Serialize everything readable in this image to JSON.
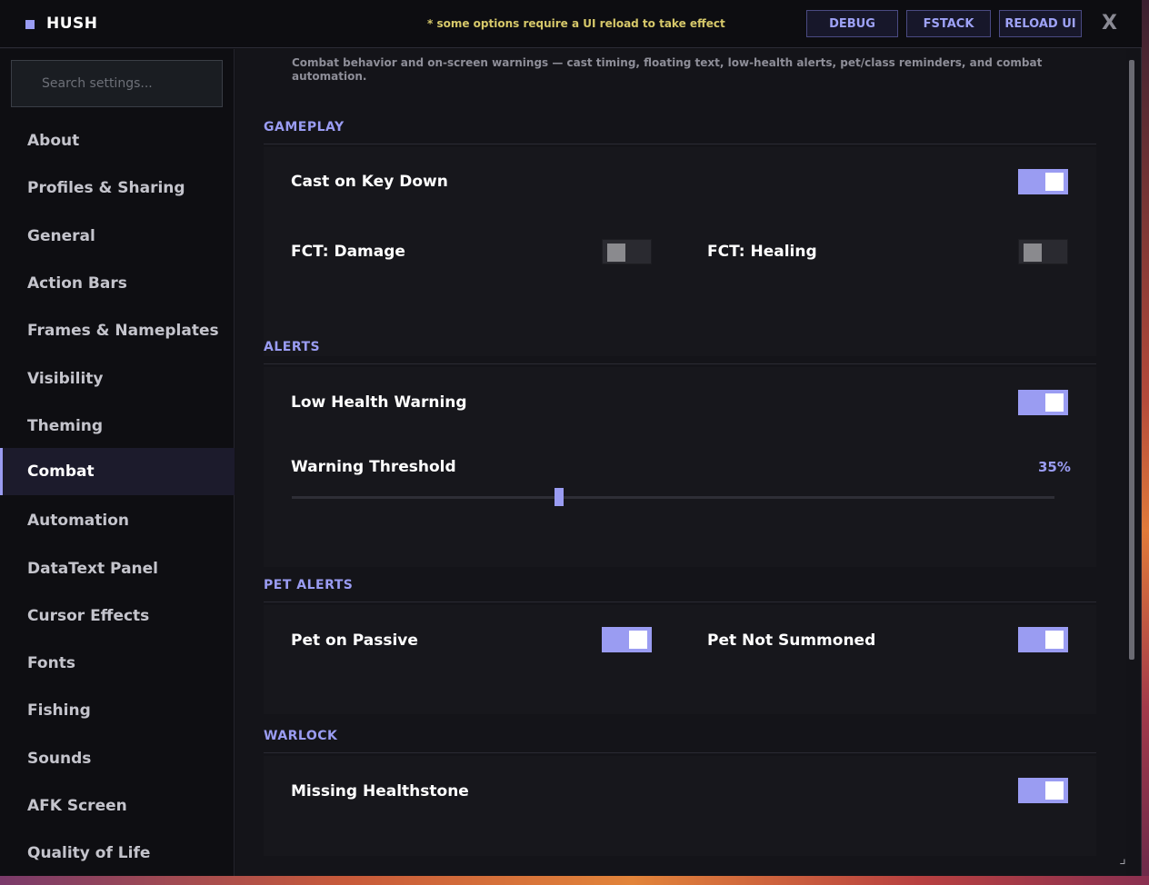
{
  "app": {
    "title": "HUSH",
    "reload_note": "* some options require a UI reload to take effect",
    "buttons": {
      "debug": "DEBUG",
      "fstack": "FSTACK",
      "reload": "RELOAD UI"
    },
    "close_label": "X"
  },
  "sidebar": {
    "search_placeholder": "Search settings...",
    "items": [
      {
        "label": "About"
      },
      {
        "label": "Profiles & Sharing"
      },
      {
        "label": "General"
      },
      {
        "label": "Action Bars"
      },
      {
        "label": "Frames & Nameplates"
      },
      {
        "label": "Visibility"
      },
      {
        "label": "Theming"
      },
      {
        "label": "Combat"
      },
      {
        "label": "Automation"
      },
      {
        "label": "DataText Panel"
      },
      {
        "label": "Cursor Effects"
      },
      {
        "label": "Fonts"
      },
      {
        "label": "Fishing"
      },
      {
        "label": "Sounds"
      },
      {
        "label": "AFK Screen"
      },
      {
        "label": "Quality of Life"
      }
    ],
    "active_item": "Combat"
  },
  "main": {
    "description": "Combat behavior and on-screen warnings — cast timing, floating text, low-health alerts, pet/class reminders, and combat automation.",
    "sections": {
      "gameplay": {
        "heading": "GAMEPLAY",
        "options": {
          "cast_on_key_down": {
            "label": "Cast on Key Down",
            "enabled": true
          },
          "fct_damage": {
            "label": "FCT: Damage",
            "enabled": false
          },
          "fct_healing": {
            "label": "FCT: Healing",
            "enabled": false
          }
        }
      },
      "alerts": {
        "heading": "ALERTS",
        "options": {
          "low_health_warning": {
            "label": "Low Health Warning",
            "enabled": true
          },
          "warning_threshold": {
            "label": "Warning Threshold",
            "value_text": "35%",
            "value": 0.35
          }
        }
      },
      "pet_alerts": {
        "heading": "PET ALERTS",
        "options": {
          "pet_on_passive": {
            "label": "Pet on Passive",
            "enabled": true
          },
          "pet_not_summoned": {
            "label": "Pet Not Summoned",
            "enabled": true
          }
        }
      },
      "warlock": {
        "heading": "WARLOCK",
        "options": {
          "missing_healthstone": {
            "label": "Missing Healthstone",
            "enabled": true
          }
        }
      }
    }
  },
  "colors": {
    "accent": "#9a9cf2",
    "note": "#d6c86a",
    "background": "#131318"
  }
}
